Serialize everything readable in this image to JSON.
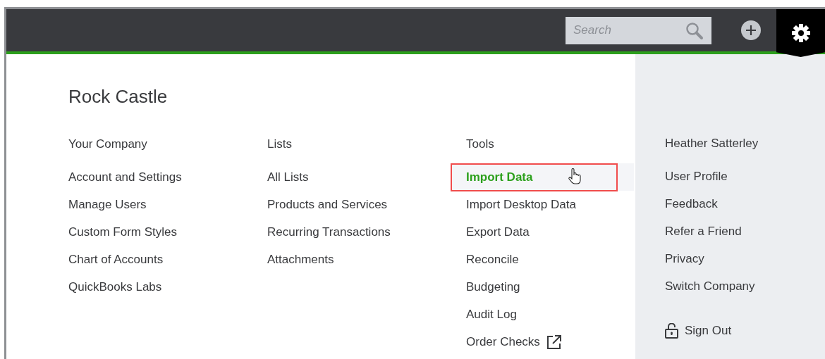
{
  "top_bar": {
    "search": {
      "placeholder": "Search"
    }
  },
  "company": {
    "name": "Rock Castle"
  },
  "columns": [
    {
      "heading": "Your Company",
      "items": [
        {
          "label": "Account and Settings",
          "selected": false,
          "kind": "link"
        },
        {
          "label": "Manage Users",
          "selected": false,
          "kind": "link"
        },
        {
          "label": "Custom Form Styles",
          "selected": false,
          "kind": "link"
        },
        {
          "label": "Chart of Accounts",
          "selected": false,
          "kind": "link"
        },
        {
          "label": "QuickBooks Labs",
          "selected": false,
          "kind": "link"
        }
      ]
    },
    {
      "heading": "Lists",
      "items": [
        {
          "label": "All Lists",
          "selected": false,
          "kind": "link"
        },
        {
          "label": "Products and Services",
          "selected": false,
          "kind": "link"
        },
        {
          "label": "Recurring Transactions",
          "selected": false,
          "kind": "link"
        },
        {
          "label": "Attachments",
          "selected": false,
          "kind": "link"
        }
      ]
    },
    {
      "heading": "Tools",
      "items": [
        {
          "label": "Import Data",
          "selected": true,
          "kind": "link"
        },
        {
          "label": "Import Desktop Data",
          "selected": false,
          "kind": "link"
        },
        {
          "label": "Export Data",
          "selected": false,
          "kind": "link"
        },
        {
          "label": "Reconcile",
          "selected": false,
          "kind": "link"
        },
        {
          "label": "Budgeting",
          "selected": false,
          "kind": "link"
        },
        {
          "label": "Audit Log",
          "selected": false,
          "kind": "link"
        },
        {
          "label": "Order Checks",
          "selected": false,
          "kind": "external"
        }
      ]
    }
  ],
  "user_panel": {
    "name": "Heather Satterley",
    "items": [
      {
        "label": "User Profile"
      },
      {
        "label": "Feedback"
      },
      {
        "label": "Refer a Friend"
      },
      {
        "label": "Privacy"
      },
      {
        "label": "Switch Company"
      }
    ],
    "sign_out": "Sign Out"
  }
}
